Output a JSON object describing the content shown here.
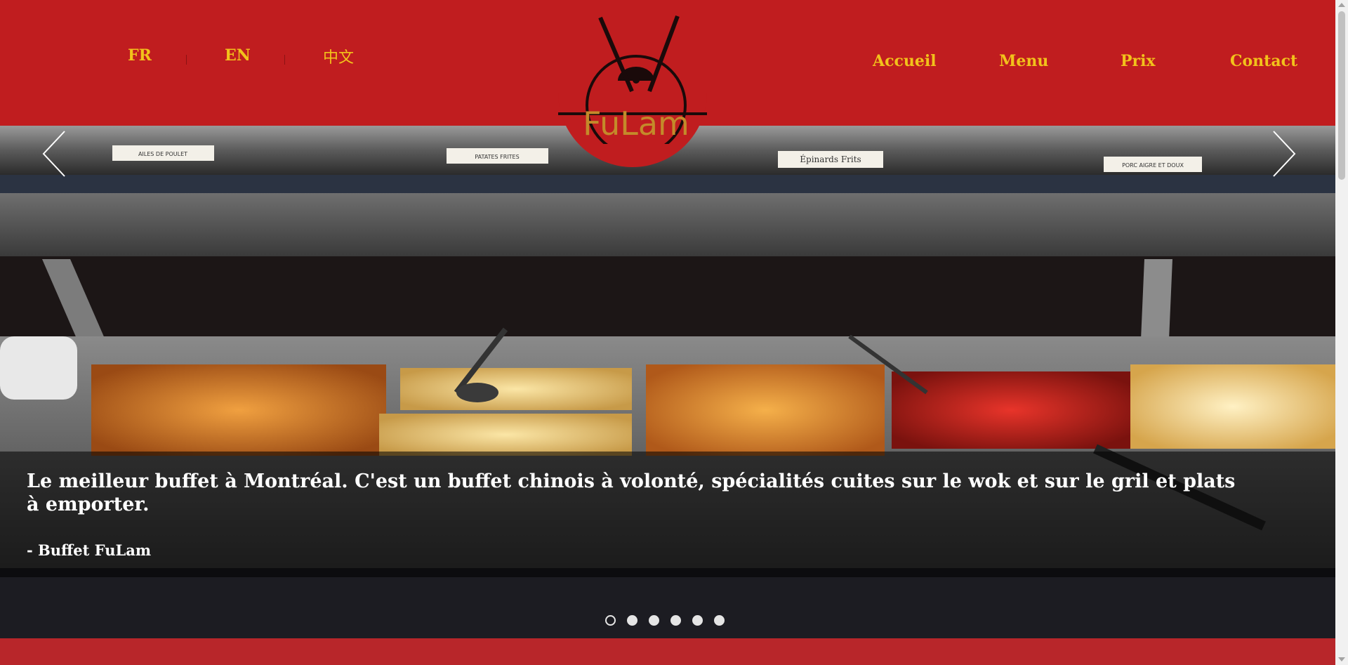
{
  "header": {
    "languages": [
      {
        "label": "FR"
      },
      {
        "label": "EN"
      },
      {
        "label": "中文"
      }
    ],
    "logo": {
      "text": "FuLam"
    },
    "nav": [
      {
        "label": "Accueil"
      },
      {
        "label": "Menu"
      },
      {
        "label": "Prix"
      },
      {
        "label": "Contact"
      }
    ]
  },
  "slider": {
    "caption": "Le meilleur buffet à Montréal. C'est un buffet chinois à volonté, spécialités cuites sur le wok et sur le gril et plats à emporter.",
    "author": "- Buffet FuLam",
    "prev_icon": "chevron-left-icon",
    "next_icon": "chevron-right-icon",
    "slide_count": 6,
    "active_slide": 1,
    "signs": [
      "AILES DE POULET",
      "PATATES FRITES",
      "Épinards Frits",
      "PORC AIGRE ET DOUX"
    ]
  },
  "colors": {
    "brand_red": "#c01d1f",
    "accent_gold": "#f2c21b",
    "band_red": "#b8262a"
  }
}
